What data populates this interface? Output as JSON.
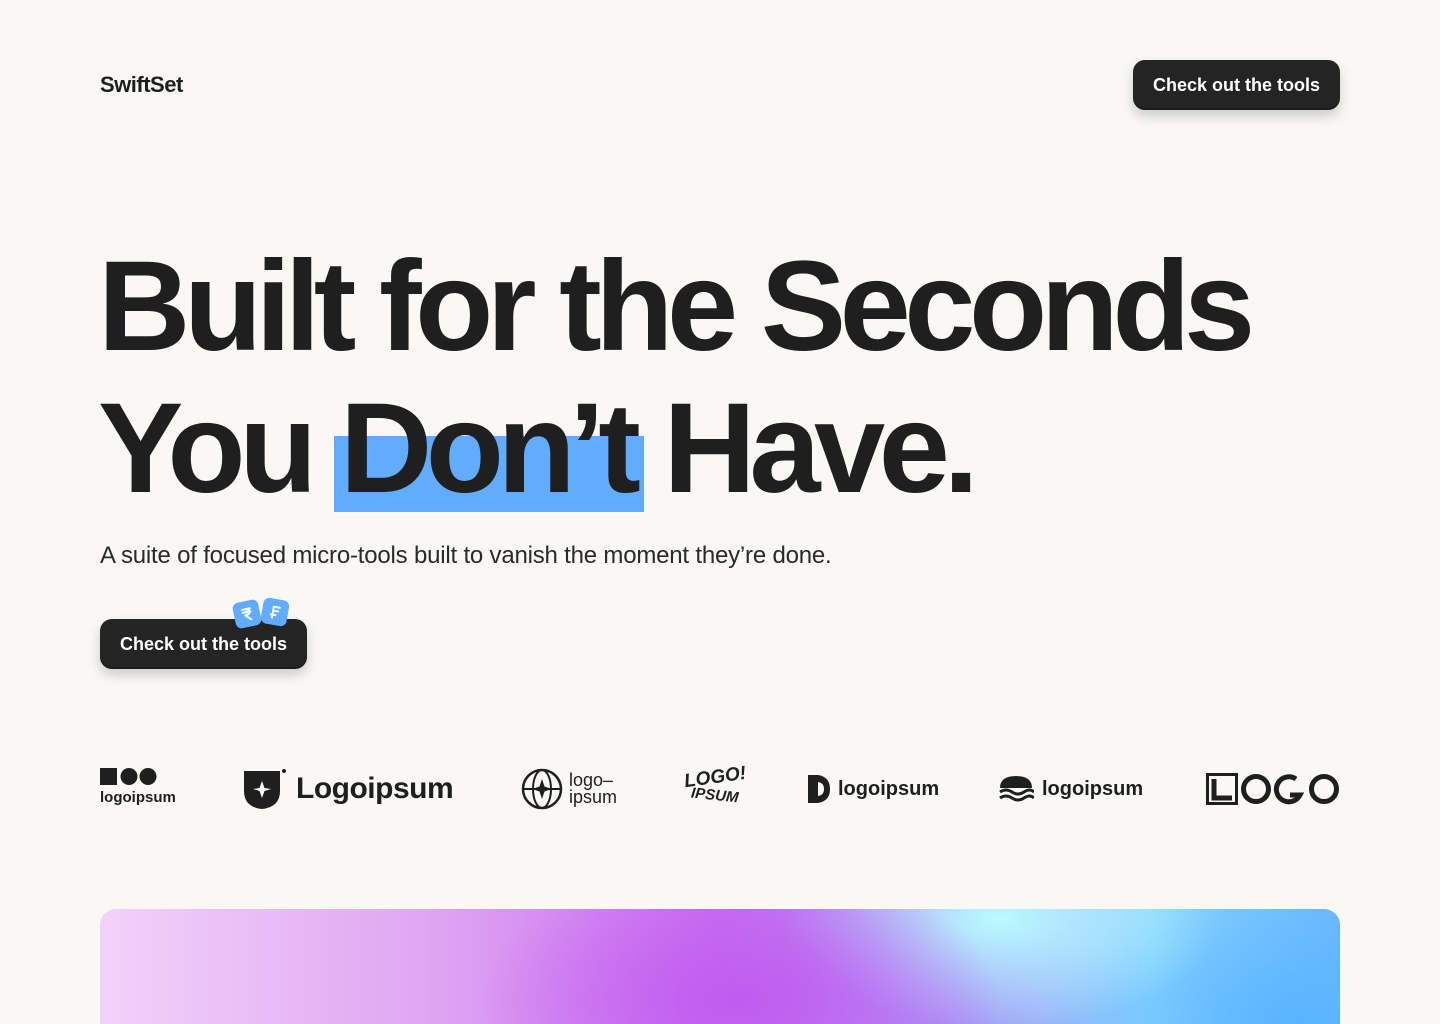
{
  "header": {
    "brand": "SwiftSet",
    "cta_label": "Check out the tools"
  },
  "hero": {
    "line1": "Built for the Seconds",
    "line2_before": "You",
    "line2_highlight": "Don’t",
    "line2_after": "Have.",
    "subtitle": "A suite of focused micro-tools built to vanish the moment they’re done.",
    "cta_label": "Check out the tools",
    "badge_icons": [
      "rupee-icon",
      "franc-icon"
    ]
  },
  "logos": [
    {
      "name": "logo-1",
      "text": "logoipsum"
    },
    {
      "name": "logo-2",
      "text": "Logoipsum"
    },
    {
      "name": "logo-3",
      "text_top": "logo–",
      "text_bottom": "ipsum"
    },
    {
      "name": "logo-4",
      "text_top": "LOGO!",
      "text_bottom": "IPSUM"
    },
    {
      "name": "logo-5",
      "text": "logoipsum"
    },
    {
      "name": "logo-6",
      "text": "logoipsum"
    },
    {
      "name": "logo-7",
      "text": "LOGO"
    }
  ],
  "colors": {
    "background": "#f9f8f4",
    "text": "#1f1f1f",
    "button": "#242424",
    "highlight": "#62acff"
  }
}
